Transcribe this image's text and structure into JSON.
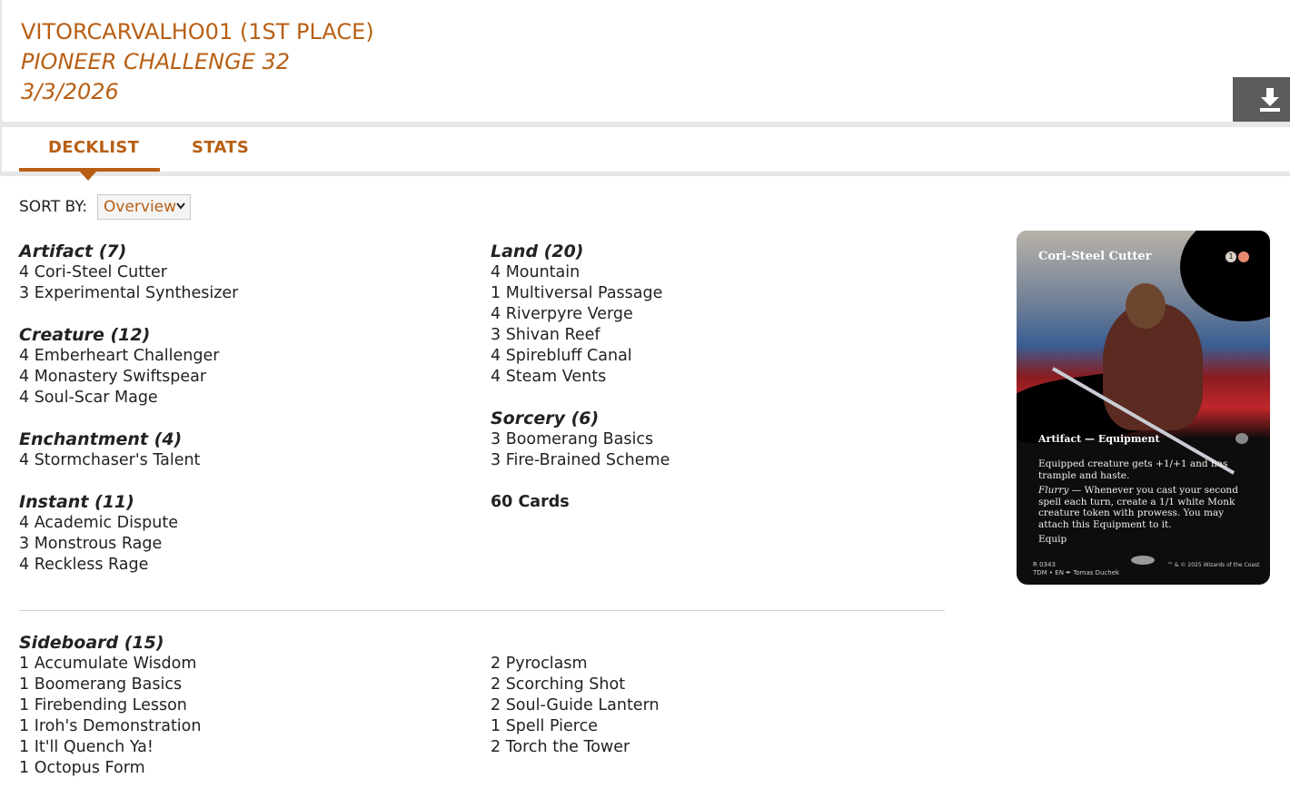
{
  "header": {
    "player": "VITORCARVALHO01 (1ST PLACE)",
    "event": "PIONEER CHALLENGE 32",
    "date": "3/3/2026",
    "download_icon": "download-icon"
  },
  "tabs": [
    {
      "label": "DECKLIST",
      "active": true
    },
    {
      "label": "STATS",
      "active": false
    }
  ],
  "sort": {
    "label": "SORT BY:",
    "selected": "Overview"
  },
  "main_left": [
    {
      "heading": "Artifact (7)",
      "cards": [
        "4 Cori-Steel Cutter",
        "3 Experimental Synthesizer"
      ]
    },
    {
      "heading": "Creature (12)",
      "cards": [
        "4 Emberheart Challenger",
        "4 Monastery Swiftspear",
        "4 Soul-Scar Mage"
      ]
    },
    {
      "heading": "Enchantment (4)",
      "cards": [
        "4 Stormchaser's Talent"
      ]
    },
    {
      "heading": "Instant (11)",
      "cards": [
        "4 Academic Dispute",
        "3 Monstrous Rage",
        "4 Reckless Rage"
      ]
    }
  ],
  "main_right": [
    {
      "heading": "Land (20)",
      "cards": [
        "4 Mountain",
        "1 Multiversal Passage",
        "4 Riverpyre Verge",
        "3 Shivan Reef",
        "4 Spirebluff Canal",
        "4 Steam Vents"
      ]
    },
    {
      "heading": "Sorcery (6)",
      "cards": [
        "3 Boomerang Basics",
        "3 Fire-Brained Scheme"
      ]
    }
  ],
  "total": "60 Cards",
  "sideboard": {
    "heading": "Sideboard (15)",
    "left": [
      "1 Accumulate Wisdom",
      "1 Boomerang Basics",
      "1 Firebending Lesson",
      "1 Iroh's Demonstration",
      "1 It'll Quench Ya!",
      "1 Octopus Form"
    ],
    "right": [
      "2 Pyroclasm",
      "2 Scorching Shot",
      "2 Soul-Guide Lantern",
      "1 Spell Pierce",
      "2 Torch the Tower"
    ]
  },
  "card_preview": {
    "name": "Cori-Steel Cutter",
    "mana": [
      "1",
      "R"
    ],
    "type": "Artifact — Equipment",
    "rules1": "Equipped creature gets +1/+1 and has trample and haste.",
    "flurry": "Flurry",
    "rules2": " — Whenever you cast your second spell each turn, create a 1/1 white Monk creature token with prowess. You may attach this Equipment to it.",
    "equip": "Equip",
    "collector": "R 0343",
    "set_line": "TDM • EN ✒ Tomas Duchek",
    "copyright": "™ & © 2025 Wizards of the Coast"
  },
  "colors": {
    "accent": "#b85f14",
    "download_bg": "#5c5c5c"
  }
}
